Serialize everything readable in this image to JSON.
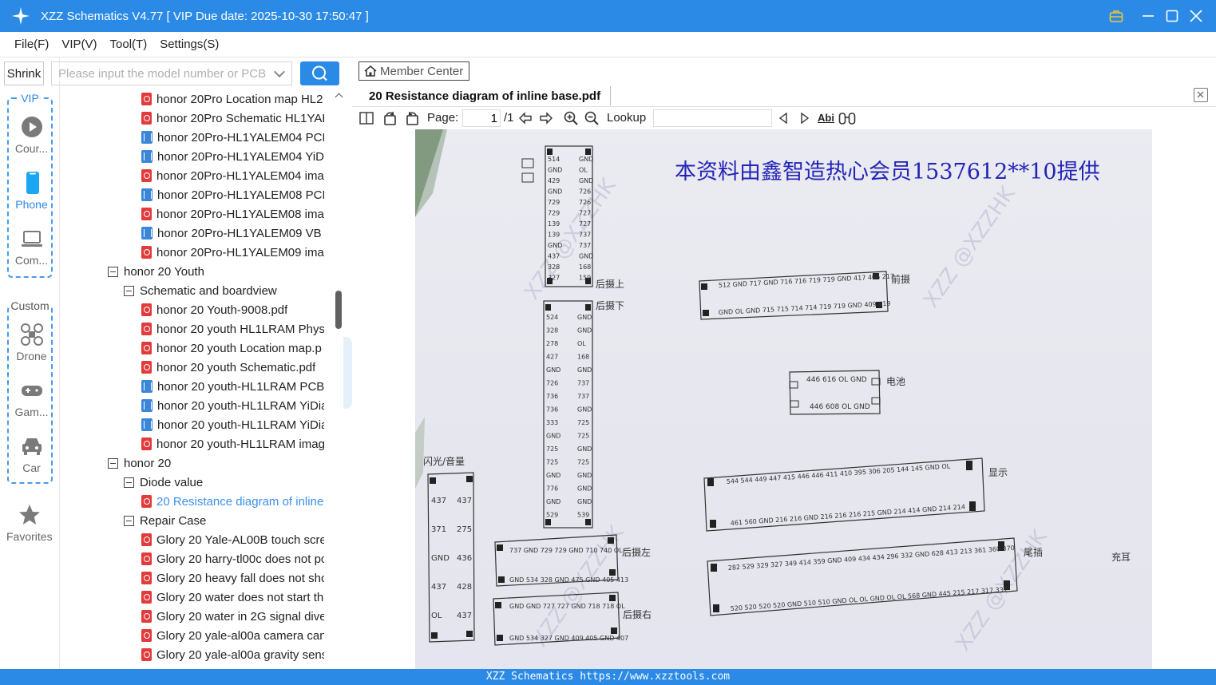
{
  "window": {
    "title": "XZZ Schematics V4.77 [ VIP Due date: 2025-10-30 17:50:47 ]"
  },
  "menu": [
    "File(F)",
    "VIP(V)",
    "Tool(T)",
    "Settings(S)"
  ],
  "sidebar": {
    "shrink_label": "Shrink",
    "vip_group_label": "VIP",
    "custom_group_label": "Custom",
    "items": [
      {
        "label": "Cour...",
        "icon": "play-icon"
      },
      {
        "label": "Phone",
        "icon": "phone-icon",
        "active": true
      },
      {
        "label": "Com...",
        "icon": "laptop-icon"
      },
      {
        "label": "Drone",
        "icon": "drone-icon"
      },
      {
        "label": "Gam...",
        "icon": "gamepad-icon"
      },
      {
        "label": "Car",
        "icon": "car-icon"
      }
    ],
    "favorites_label": "Favorites"
  },
  "search": {
    "placeholder": "Please input the model number or PCB"
  },
  "tree": {
    "rows": [
      {
        "type": "pdf",
        "indent": 2,
        "label": "honor 20Pro Location map HL2"
      },
      {
        "type": "pdf",
        "indent": 2,
        "label": "honor 20Pro Schematic HL1YAL"
      },
      {
        "type": "pcb",
        "indent": 2,
        "label": "honor 20Pro-HL1YALEM04 PCB"
      },
      {
        "type": "pcb",
        "indent": 2,
        "label": "honor 20Pro-HL1YALEM04 YiDi"
      },
      {
        "type": "pdf",
        "indent": 2,
        "label": "honor 20Pro-HL1YALEM04 imag"
      },
      {
        "type": "pcb",
        "indent": 2,
        "label": "honor 20Pro-HL1YALEM08 PCB"
      },
      {
        "type": "pdf",
        "indent": 2,
        "label": "honor 20Pro-HL1YALEM08 imag"
      },
      {
        "type": "pcb",
        "indent": 2,
        "label": "honor 20Pro-HL1YALEM09 VB F"
      },
      {
        "type": "pdf",
        "indent": 2,
        "label": "honor 20Pro-HL1YALEM09 imag"
      },
      {
        "type": "folder",
        "indent": 0,
        "label": "honor 20 Youth"
      },
      {
        "type": "folder",
        "indent": 1,
        "label": "Schematic and boardview"
      },
      {
        "type": "pdf",
        "indent": 2,
        "label": "honor 20 Youth-9008.pdf"
      },
      {
        "type": "pdf",
        "indent": 2,
        "label": "honor 20 youth HL1LRAM Physi"
      },
      {
        "type": "pdf",
        "indent": 2,
        "label": "honor 20 youth Location map.p"
      },
      {
        "type": "pdf",
        "indent": 2,
        "label": "honor 20 youth Schematic.pdf"
      },
      {
        "type": "pcb",
        "indent": 2,
        "label": "honor 20 youth-HL1LRAM PCB"
      },
      {
        "type": "pcb",
        "indent": 2,
        "label": "honor 20 youth-HL1LRAM YiDia"
      },
      {
        "type": "pcb",
        "indent": 2,
        "label": "honor 20 youth-HL1LRAM YiDia"
      },
      {
        "type": "pdf",
        "indent": 2,
        "label": "honor 20 youth-HL1LRAM imag"
      },
      {
        "type": "folder",
        "indent": 0,
        "label": "honor 20"
      },
      {
        "type": "folder",
        "indent": 1,
        "label": "Diode value"
      },
      {
        "type": "pdf",
        "indent": 2,
        "label": "20 Resistance diagram of inline",
        "selected": true
      },
      {
        "type": "folder",
        "indent": 1,
        "label": "Repair Case"
      },
      {
        "type": "pdf",
        "indent": 2,
        "label": "Glory 20 Yale-AL00B touch scree"
      },
      {
        "type": "pdf",
        "indent": 2,
        "label": "Glory 20 harry-tl00c does not pc"
      },
      {
        "type": "pdf",
        "indent": 2,
        "label": "Glory 20 heavy fall does not shc"
      },
      {
        "type": "pdf",
        "indent": 2,
        "label": "Glory 20 water does not start th"
      },
      {
        "type": "pdf",
        "indent": 2,
        "label": "Glory 20 water in 2G signal dive"
      },
      {
        "type": "pdf",
        "indent": 2,
        "label": "Glory 20 yale-al00a camera can"
      },
      {
        "type": "pdf",
        "indent": 2,
        "label": "Glory 20 yale-al00a gravity sens"
      }
    ]
  },
  "viewer": {
    "member_center_label": "Member Center",
    "tab_title": "20 Resistance diagram of inline base.pdf",
    "page_label": "Page:",
    "page_current": "1",
    "page_total": "/1",
    "lookup_label": "Lookup",
    "abi_label": "Abi",
    "document": {
      "header_text": "本资料由鑫智造热心会员1537612**10提供",
      "watermark": "XZZ @XZZHK",
      "labels": [
        "后摄上",
        "后摄下",
        "前摄",
        "电池",
        "显示",
        "后摄左",
        "后摄右",
        "尾插",
        "充耳",
        "闪光/音量",
        "指纹"
      ],
      "left_column_values": [
        "514",
        "GND",
        "429",
        "GND",
        "729",
        "729",
        "139",
        "139",
        "GND",
        "437",
        "328",
        "327"
      ],
      "left_column_values_right": [
        "GND",
        "OL",
        "GND",
        "726",
        "726",
        "727",
        "727",
        "737",
        "737",
        "GND",
        "168",
        "159"
      ],
      "mid_column_values": [
        "524",
        "328",
        "278",
        "427",
        "GND",
        "726",
        "736",
        "736",
        "333",
        "GND",
        "725",
        "725",
        "GND",
        "776",
        "GND",
        "529"
      ],
      "mid_column_values_right": [
        "GND",
        "GND",
        "OL",
        "168",
        "GND",
        "737",
        "737",
        "GND",
        "725",
        "725",
        "GND",
        "725",
        "GND",
        "GND",
        "GND",
        "539"
      ],
      "front_cam_top": "512 GND 717 GND 716 716 719 719 GND 417 406 217",
      "front_cam_bottom": "GND OL GND 715 715 714 714 719 719 GND 409 419",
      "battery_top": "446 616 OL GND",
      "battery_bottom": "446 608 OL GND",
      "display_top": "544 544 449 447 415 446 446 411 410 395 306 205 144 145 GND OL",
      "display_bottom": "461 560 GND 216 216 GND 216 216 216 215 GND 214 414 GND 214 214",
      "usb_top": "282 529 329 327 349 414 359 GND 409 434 434 296 332 GND 628 413 213 361 360 370",
      "usb_bottom": "520 520 520 520 GND 510 510 GND OL OL GND OL OL 568 GND 445 215 217 317 337",
      "rear_left_top": "737 GND 729 729 GND 710 740 OL",
      "rear_left_bottom": "GND 534 328 GND 475 GND 405 413",
      "rear_right_top": "GND GND 727 727 GND 718 718 OL",
      "rear_right_bottom": "GND 534 327 GND 409 405 GND 407",
      "left_edge_values": [
        "437",
        "437",
        "371",
        "275",
        "GND",
        "436",
        "437",
        "428",
        "OL",
        "437"
      ]
    }
  },
  "statusbar": {
    "text": "XZZ Schematics https://www.xzztools.com"
  },
  "colors": {
    "accent": "#2a8ae6",
    "pdf_icon": "#e23b3b",
    "pcb_icon": "#3a86d9",
    "selected_text": "#3b8ff0",
    "handwritten_header": "#2424b8"
  }
}
